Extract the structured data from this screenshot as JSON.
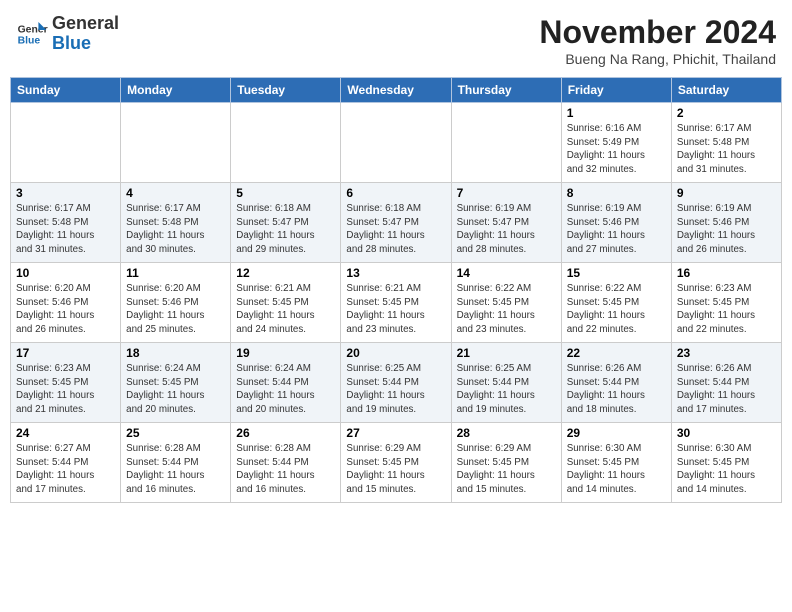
{
  "header": {
    "logo_line1": "General",
    "logo_line2": "Blue",
    "main_title": "November 2024",
    "subtitle": "Bueng Na Rang, Phichit, Thailand"
  },
  "weekdays": [
    "Sunday",
    "Monday",
    "Tuesday",
    "Wednesday",
    "Thursday",
    "Friday",
    "Saturday"
  ],
  "weeks": [
    [
      {
        "date": "",
        "info": ""
      },
      {
        "date": "",
        "info": ""
      },
      {
        "date": "",
        "info": ""
      },
      {
        "date": "",
        "info": ""
      },
      {
        "date": "",
        "info": ""
      },
      {
        "date": "1",
        "info": "Sunrise: 6:16 AM\nSunset: 5:49 PM\nDaylight: 11 hours\nand 32 minutes."
      },
      {
        "date": "2",
        "info": "Sunrise: 6:17 AM\nSunset: 5:48 PM\nDaylight: 11 hours\nand 31 minutes."
      }
    ],
    [
      {
        "date": "3",
        "info": "Sunrise: 6:17 AM\nSunset: 5:48 PM\nDaylight: 11 hours\nand 31 minutes."
      },
      {
        "date": "4",
        "info": "Sunrise: 6:17 AM\nSunset: 5:48 PM\nDaylight: 11 hours\nand 30 minutes."
      },
      {
        "date": "5",
        "info": "Sunrise: 6:18 AM\nSunset: 5:47 PM\nDaylight: 11 hours\nand 29 minutes."
      },
      {
        "date": "6",
        "info": "Sunrise: 6:18 AM\nSunset: 5:47 PM\nDaylight: 11 hours\nand 28 minutes."
      },
      {
        "date": "7",
        "info": "Sunrise: 6:19 AM\nSunset: 5:47 PM\nDaylight: 11 hours\nand 28 minutes."
      },
      {
        "date": "8",
        "info": "Sunrise: 6:19 AM\nSunset: 5:46 PM\nDaylight: 11 hours\nand 27 minutes."
      },
      {
        "date": "9",
        "info": "Sunrise: 6:19 AM\nSunset: 5:46 PM\nDaylight: 11 hours\nand 26 minutes."
      }
    ],
    [
      {
        "date": "10",
        "info": "Sunrise: 6:20 AM\nSunset: 5:46 PM\nDaylight: 11 hours\nand 26 minutes."
      },
      {
        "date": "11",
        "info": "Sunrise: 6:20 AM\nSunset: 5:46 PM\nDaylight: 11 hours\nand 25 minutes."
      },
      {
        "date": "12",
        "info": "Sunrise: 6:21 AM\nSunset: 5:45 PM\nDaylight: 11 hours\nand 24 minutes."
      },
      {
        "date": "13",
        "info": "Sunrise: 6:21 AM\nSunset: 5:45 PM\nDaylight: 11 hours\nand 23 minutes."
      },
      {
        "date": "14",
        "info": "Sunrise: 6:22 AM\nSunset: 5:45 PM\nDaylight: 11 hours\nand 23 minutes."
      },
      {
        "date": "15",
        "info": "Sunrise: 6:22 AM\nSunset: 5:45 PM\nDaylight: 11 hours\nand 22 minutes."
      },
      {
        "date": "16",
        "info": "Sunrise: 6:23 AM\nSunset: 5:45 PM\nDaylight: 11 hours\nand 22 minutes."
      }
    ],
    [
      {
        "date": "17",
        "info": "Sunrise: 6:23 AM\nSunset: 5:45 PM\nDaylight: 11 hours\nand 21 minutes."
      },
      {
        "date": "18",
        "info": "Sunrise: 6:24 AM\nSunset: 5:45 PM\nDaylight: 11 hours\nand 20 minutes."
      },
      {
        "date": "19",
        "info": "Sunrise: 6:24 AM\nSunset: 5:44 PM\nDaylight: 11 hours\nand 20 minutes."
      },
      {
        "date": "20",
        "info": "Sunrise: 6:25 AM\nSunset: 5:44 PM\nDaylight: 11 hours\nand 19 minutes."
      },
      {
        "date": "21",
        "info": "Sunrise: 6:25 AM\nSunset: 5:44 PM\nDaylight: 11 hours\nand 19 minutes."
      },
      {
        "date": "22",
        "info": "Sunrise: 6:26 AM\nSunset: 5:44 PM\nDaylight: 11 hours\nand 18 minutes."
      },
      {
        "date": "23",
        "info": "Sunrise: 6:26 AM\nSunset: 5:44 PM\nDaylight: 11 hours\nand 17 minutes."
      }
    ],
    [
      {
        "date": "24",
        "info": "Sunrise: 6:27 AM\nSunset: 5:44 PM\nDaylight: 11 hours\nand 17 minutes."
      },
      {
        "date": "25",
        "info": "Sunrise: 6:28 AM\nSunset: 5:44 PM\nDaylight: 11 hours\nand 16 minutes."
      },
      {
        "date": "26",
        "info": "Sunrise: 6:28 AM\nSunset: 5:44 PM\nDaylight: 11 hours\nand 16 minutes."
      },
      {
        "date": "27",
        "info": "Sunrise: 6:29 AM\nSunset: 5:45 PM\nDaylight: 11 hours\nand 15 minutes."
      },
      {
        "date": "28",
        "info": "Sunrise: 6:29 AM\nSunset: 5:45 PM\nDaylight: 11 hours\nand 15 minutes."
      },
      {
        "date": "29",
        "info": "Sunrise: 6:30 AM\nSunset: 5:45 PM\nDaylight: 11 hours\nand 14 minutes."
      },
      {
        "date": "30",
        "info": "Sunrise: 6:30 AM\nSunset: 5:45 PM\nDaylight: 11 hours\nand 14 minutes."
      }
    ]
  ]
}
